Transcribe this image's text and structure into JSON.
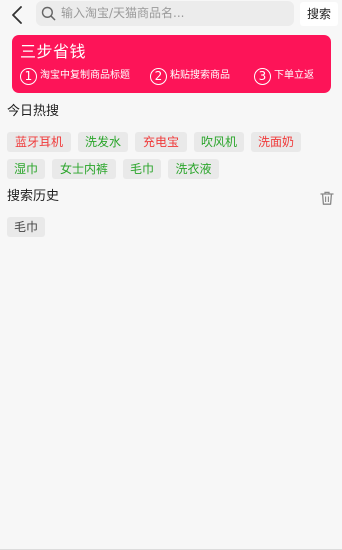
{
  "search": {
    "placeholder": "输入淘宝/天猫商品名...",
    "button_label": "搜索"
  },
  "banner": {
    "title": "三步省钱",
    "steps": [
      {
        "num": "1",
        "text": "淘宝中复制商品标题"
      },
      {
        "num": "2",
        "text": "粘贴搜索商品"
      },
      {
        "num": "3",
        "text": "下单立返"
      }
    ],
    "background": "#fd1458"
  },
  "hot": {
    "title": "今日热搜",
    "tags": [
      {
        "label": "蓝牙耳机",
        "color": "red"
      },
      {
        "label": "洗发水",
        "color": "green"
      },
      {
        "label": "充电宝",
        "color": "red"
      },
      {
        "label": "吹风机",
        "color": "green"
      },
      {
        "label": "洗面奶",
        "color": "red"
      },
      {
        "label": "湿巾",
        "color": "green"
      },
      {
        "label": "女士内裤",
        "color": "green"
      },
      {
        "label": "毛巾",
        "color": "green"
      },
      {
        "label": "洗衣液",
        "color": "green"
      }
    ]
  },
  "history": {
    "title": "搜索历史",
    "tags": [
      {
        "label": "毛巾"
      }
    ]
  },
  "icons": {
    "back": "chevron-left-icon",
    "search": "search-icon",
    "delete": "trash-icon"
  },
  "colors": {
    "tag_red": "#f03a3a",
    "tag_green": "#2aa52a",
    "tag_bg": "#e9e9e9",
    "page_bg": "#f7f7f7"
  }
}
